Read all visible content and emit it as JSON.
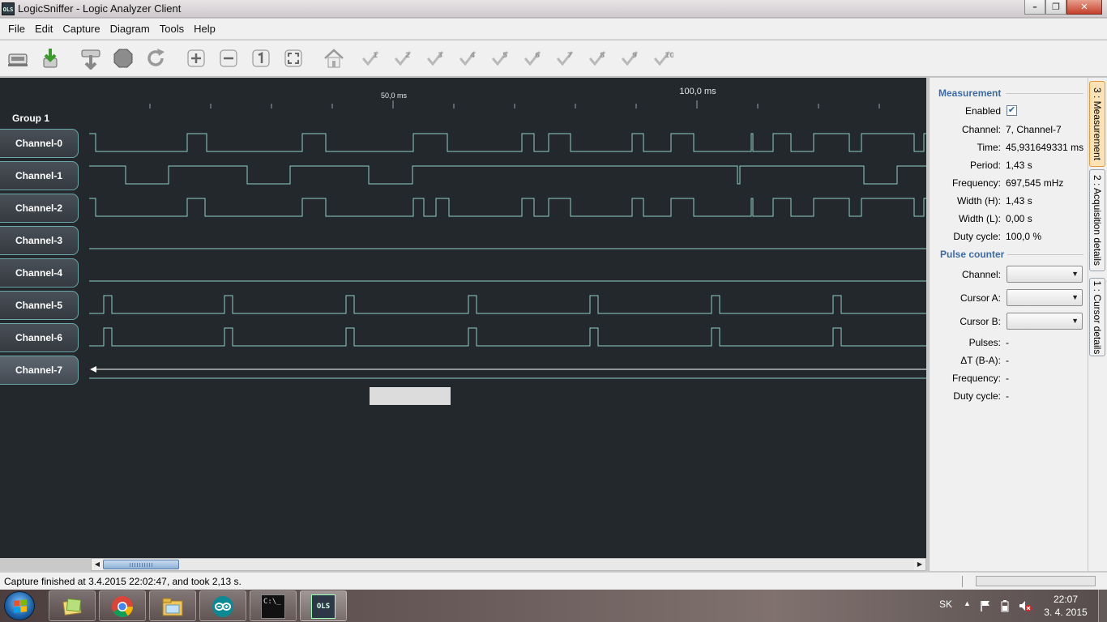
{
  "window": {
    "app_icon": "OLS",
    "title": "LogicSniffer - Logic Analyzer Client",
    "minimize": "–",
    "maximize": "❐",
    "close": "✕"
  },
  "menu": [
    "File",
    "Edit",
    "Capture",
    "Diagram",
    "Tools",
    "Help"
  ],
  "toolbar_icons": [
    "capture-device-icon",
    "export-icon",
    "repeat-capture-icon",
    "stop-icon",
    "refresh-icon",
    "zoom-in-icon",
    "zoom-out-icon",
    "zoom-original-icon",
    "zoom-all-icon",
    "goto-trigger-icon",
    "cursor-1-icon",
    "cursor-2-icon",
    "cursor-3-icon",
    "cursor-4-icon",
    "cursor-5-icon",
    "cursor-6-icon",
    "cursor-7-icon",
    "cursor-8-icon",
    "cursor-9-icon",
    "cursor-10-icon"
  ],
  "cursor_numbers": [
    "1",
    "2",
    "3",
    "4",
    "5",
    "6",
    "7",
    "8",
    "9",
    "10"
  ],
  "diagram": {
    "timeline": {
      "label_50": "50,0 ms",
      "label_100": "100,0 ms"
    },
    "group_title": "Group 1",
    "channels": [
      "Channel-0",
      "Channel-1",
      "Channel-2",
      "Channel-3",
      "Channel-4",
      "Channel-5",
      "Channel-6",
      "Channel-7"
    ],
    "selected_channel": "Channel-7",
    "colors": {
      "background": "#23282c",
      "signal": "#8fd0c8",
      "selected_signal": "#ffffff"
    }
  },
  "status": {
    "message": "Capture finished at 3.4.2015 22:02:47, and took 2,13 s."
  },
  "measurement": {
    "title": "Measurement",
    "enabled_label": "Enabled",
    "enabled": true,
    "rows": [
      {
        "label": "Channel:",
        "value": "7, Channel-7"
      },
      {
        "label": "Time:",
        "value": "45,931649331 ms"
      },
      {
        "label": "Period:",
        "value": "1,43 s"
      },
      {
        "label": "Frequency:",
        "value": "697,545 mHz"
      },
      {
        "label": "Width (H):",
        "value": "1,43 s"
      },
      {
        "label": "Width (L):",
        "value": "0,00 s"
      },
      {
        "label": "Duty cycle:",
        "value": "100,0 %"
      }
    ]
  },
  "pulse_counter": {
    "title": "Pulse counter",
    "channel_label": "Channel:",
    "cursor_a_label": "Cursor A:",
    "cursor_b_label": "Cursor B:",
    "rows": [
      {
        "label": "Pulses:",
        "value": "-"
      },
      {
        "label": "ΔT (B-A):",
        "value": "-"
      },
      {
        "label": "Frequency:",
        "value": "-"
      },
      {
        "label": "Duty cycle:",
        "value": "-"
      }
    ]
  },
  "side_tabs": [
    "3 : Measurement",
    "2 : Acquisition details",
    "1 : Cursor details"
  ],
  "taskbar": {
    "apps": [
      "explorer-icon",
      "chrome-icon",
      "file-manager-icon",
      "arduino-icon",
      "cmd-icon",
      "ols-icon"
    ],
    "cmd_label": "C:\\_",
    "ols_label": "OLS",
    "language": "SK",
    "time": "22:07",
    "date": "3. 4. 2015"
  }
}
